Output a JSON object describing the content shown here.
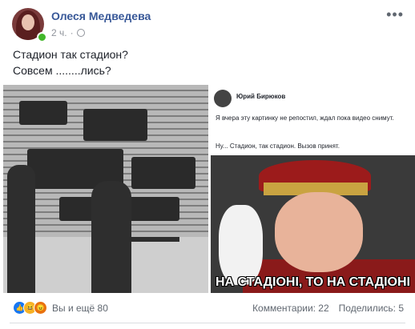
{
  "post": {
    "author": "Олеся Медведева",
    "time": "2 ч.",
    "text_lines": [
      "Стадион так стадион?",
      "Совсем ........лись?"
    ]
  },
  "embedded": {
    "author": "Юрий Бирюков",
    "text1": "Я вчера эту картинку не репостил, ждал пока видео снимут.",
    "text2": "Ну... Стадион, так стадион. Вызов принят.",
    "caption": "НА СТАДІОНІ, ТО НА СТАДІОНІ"
  },
  "footer": {
    "reactions_label": "Вы и ещё 80",
    "comments_label": "Комментарии: 22",
    "shares_label": "Поделились: 5"
  },
  "icons": [
    "more-icon",
    "globe-icon",
    "like-icon",
    "haha-icon",
    "angry-icon"
  ]
}
